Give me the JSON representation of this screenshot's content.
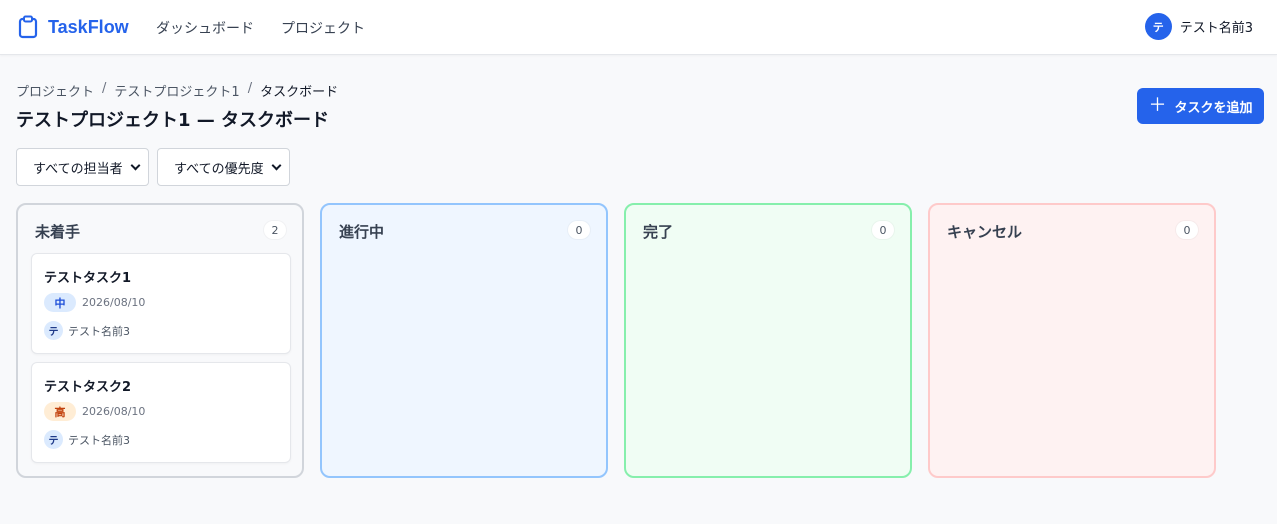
{
  "header": {
    "app_name": "TaskFlow",
    "nav": [
      {
        "label": "ダッシュボード"
      },
      {
        "label": "プロジェクト"
      }
    ],
    "user": {
      "avatar_initial": "テ",
      "name": "テスト名前3"
    }
  },
  "breadcrumb": {
    "items": [
      {
        "label": "プロジェクト"
      },
      {
        "label": "テストプロジェクト1"
      },
      {
        "label": "タスクボード"
      }
    ],
    "separator": "/"
  },
  "page": {
    "title": "テストプロジェクト1 — タスクボード",
    "add_button_label": "タスクを追加",
    "add_button_icon": "plus-icon"
  },
  "filters": {
    "assignee": {
      "selected": "すべての担当者"
    },
    "priority": {
      "selected": "すべての優先度"
    }
  },
  "columns": [
    {
      "title": "未着手",
      "count": "2"
    },
    {
      "title": "進行中",
      "count": "0"
    },
    {
      "title": "完了",
      "count": "0"
    },
    {
      "title": "キャンセル",
      "count": "0"
    }
  ],
  "tasks": [
    {
      "title": "テストタスク1",
      "priority": "中",
      "due": "2026/08/10",
      "assignee_initial": "テ",
      "assignee_name": "テスト名前3"
    },
    {
      "title": "テストタスク2",
      "priority": "高",
      "due": "2026/08/10",
      "assignee_initial": "テ",
      "assignee_name": "テスト名前3"
    }
  ],
  "colors": {
    "primary": "#2563eb",
    "todo_border": "#d1d5db",
    "progress_border": "#93c5fd",
    "done_border": "#86efac",
    "cancel_border": "#fecaca"
  }
}
